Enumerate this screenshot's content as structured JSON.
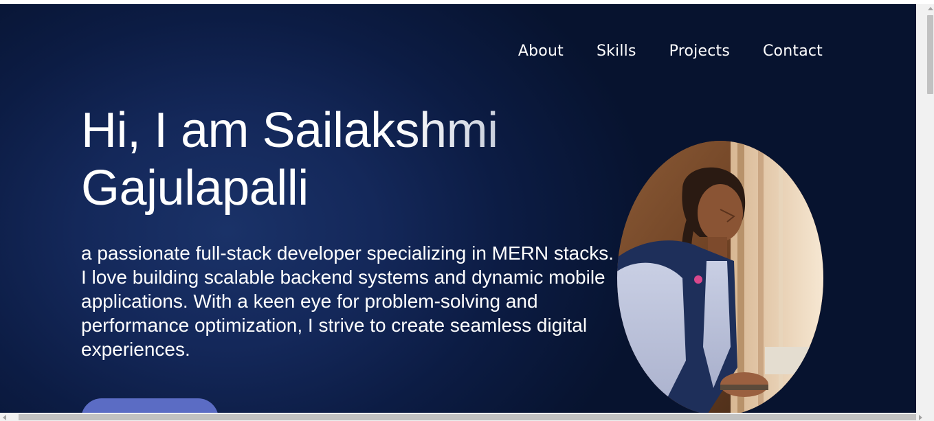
{
  "nav": {
    "items": [
      {
        "label": "About"
      },
      {
        "label": "Skills"
      },
      {
        "label": "Projects"
      },
      {
        "label": "Contact"
      }
    ]
  },
  "hero": {
    "title_line1": "Hi, I am Sailakshmi",
    "title_line2": "Gajulapalli",
    "description": "a passionate full-stack developer specializing in MERN stacks. I love building scalable backend systems and dynamic mobile applications. With a keen eye for problem-solving and performance optimization, I strive to create seamless digital experiences.",
    "cta_label": "",
    "photo_icon": "profile-photo"
  },
  "colors": {
    "background_dark": "#07132f",
    "background_glow": "#1a3268",
    "text": "#ffffff",
    "button": "#5b6cc4"
  }
}
